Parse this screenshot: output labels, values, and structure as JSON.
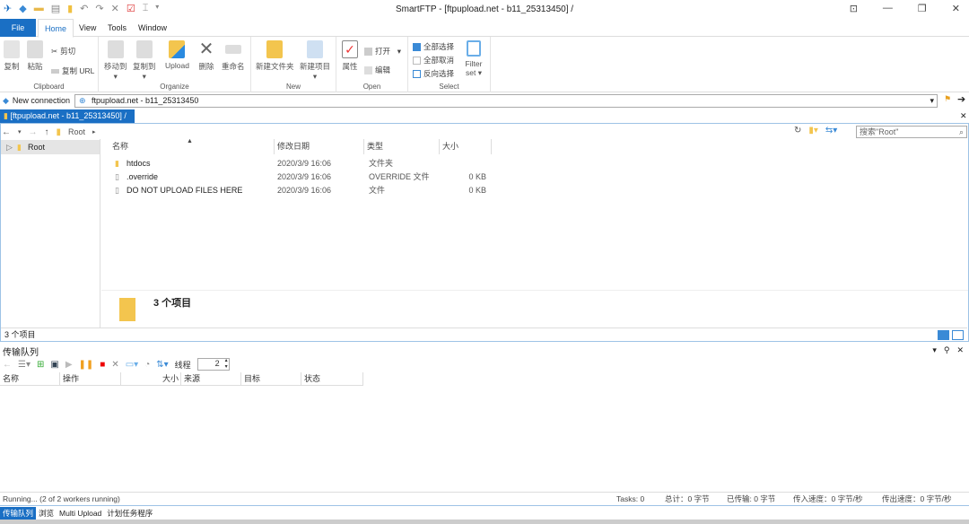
{
  "window": {
    "title": "SmartFTP - [ftpupload.net - b11_25313450] /"
  },
  "menu": {
    "file": "File",
    "tabs": [
      "Home",
      "View",
      "Tools",
      "Window"
    ]
  },
  "ribbon": {
    "clipboard": {
      "label": "Clipboard",
      "copy": "复制",
      "paste": "粘贴",
      "cut": "剪切",
      "copy_url": "复制 URL"
    },
    "organize": {
      "label": "Organize",
      "move_to": "移动到",
      "copy_to": "复制到",
      "upload": "Upload",
      "delete": "删除",
      "rename": "重命名"
    },
    "new": {
      "label": "New",
      "new_folder": "新建文件夹",
      "new_item": "新建项目"
    },
    "open": {
      "label": "Open",
      "properties": "属性",
      "open": "打开",
      "edit": "编辑"
    },
    "select": {
      "label": "Select",
      "select_all": "全部选择",
      "select_none": "全部取消",
      "invert": "反向选择",
      "filter_set": "Filter set"
    }
  },
  "address": {
    "new_connection": "New connection",
    "value": "ftpupload.net - b11_25313450"
  },
  "doc_tab": {
    "label": "[ftpupload.net - b11_25313450] /"
  },
  "browser": {
    "breadcrumb": "Root",
    "search_placeholder": "搜索\"Root\"",
    "tree": [
      {
        "label": "Root"
      }
    ],
    "columns": [
      "名称",
      "修改日期",
      "类型",
      "大小"
    ],
    "files": [
      {
        "name": "htdocs",
        "date": "2020/3/9 16:06",
        "type": "文件夹",
        "size": ""
      },
      {
        "name": ".override",
        "date": "2020/3/9 16:06",
        "type": "OVERRIDE 文件",
        "size": "0 KB"
      },
      {
        "name": "DO NOT UPLOAD FILES HERE",
        "date": "2020/3/9 16:06",
        "type": "文件",
        "size": "0 KB"
      }
    ],
    "preview_text": "3 个项目",
    "status": "3 个项目"
  },
  "queue": {
    "title": "传输队列",
    "threads_label": "线程",
    "threads_value": "2",
    "columns": [
      "名称",
      "操作",
      "大小",
      "来源",
      "目标",
      "状态"
    ]
  },
  "statusbar": {
    "running": "Running... (2 of 2 workers running)",
    "tasks": "Tasks: 0",
    "total": "总计：0 字节",
    "transferred": "已传输: 0 字节",
    "in_speed": "传入速度：0 字节/秒",
    "out_speed": "传出速度：0 字节/秒"
  },
  "bottom_tabs": [
    "传输队列",
    "浏览",
    "Multi Upload",
    "计划任务程序"
  ]
}
